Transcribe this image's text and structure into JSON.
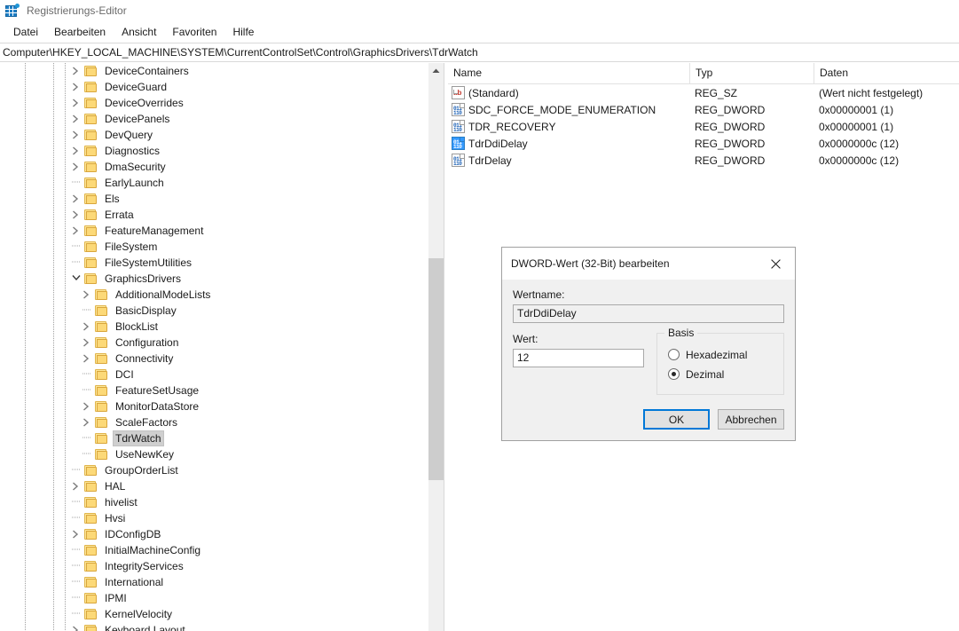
{
  "window": {
    "title": "Registrierungs-Editor",
    "icon": "registry-editor-icon"
  },
  "menubar": {
    "items": [
      {
        "label": "Datei"
      },
      {
        "label": "Bearbeiten"
      },
      {
        "label": "Ansicht"
      },
      {
        "label": "Favoriten"
      },
      {
        "label": "Hilfe"
      }
    ]
  },
  "addressbar": {
    "path": "Computer\\HKEY_LOCAL_MACHINE\\SYSTEM\\CurrentControlSet\\Control\\GraphicsDrivers\\TdrWatch"
  },
  "tree": {
    "nodes": [
      {
        "label": "DeviceContainers",
        "depth": 3,
        "twist": "collapsed",
        "selected": false
      },
      {
        "label": "DeviceGuard",
        "depth": 3,
        "twist": "collapsed",
        "selected": false
      },
      {
        "label": "DeviceOverrides",
        "depth": 3,
        "twist": "collapsed",
        "selected": false
      },
      {
        "label": "DevicePanels",
        "depth": 3,
        "twist": "collapsed",
        "selected": false
      },
      {
        "label": "DevQuery",
        "depth": 3,
        "twist": "collapsed",
        "selected": false
      },
      {
        "label": "Diagnostics",
        "depth": 3,
        "twist": "collapsed",
        "selected": false
      },
      {
        "label": "DmaSecurity",
        "depth": 3,
        "twist": "collapsed",
        "selected": false
      },
      {
        "label": "EarlyLaunch",
        "depth": 3,
        "twist": "none",
        "selected": false
      },
      {
        "label": "Els",
        "depth": 3,
        "twist": "collapsed",
        "selected": false
      },
      {
        "label": "Errata",
        "depth": 3,
        "twist": "collapsed",
        "selected": false
      },
      {
        "label": "FeatureManagement",
        "depth": 3,
        "twist": "collapsed",
        "selected": false
      },
      {
        "label": "FileSystem",
        "depth": 3,
        "twist": "none",
        "selected": false
      },
      {
        "label": "FileSystemUtilities",
        "depth": 3,
        "twist": "none",
        "selected": false
      },
      {
        "label": "GraphicsDrivers",
        "depth": 3,
        "twist": "expanded",
        "selected": false
      },
      {
        "label": "AdditionalModeLists",
        "depth": 4,
        "twist": "collapsed",
        "selected": false
      },
      {
        "label": "BasicDisplay",
        "depth": 4,
        "twist": "none",
        "selected": false
      },
      {
        "label": "BlockList",
        "depth": 4,
        "twist": "collapsed",
        "selected": false
      },
      {
        "label": "Configuration",
        "depth": 4,
        "twist": "collapsed",
        "selected": false
      },
      {
        "label": "Connectivity",
        "depth": 4,
        "twist": "collapsed",
        "selected": false
      },
      {
        "label": "DCI",
        "depth": 4,
        "twist": "none",
        "selected": false
      },
      {
        "label": "FeatureSetUsage",
        "depth": 4,
        "twist": "none",
        "selected": false
      },
      {
        "label": "MonitorDataStore",
        "depth": 4,
        "twist": "collapsed",
        "selected": false
      },
      {
        "label": "ScaleFactors",
        "depth": 4,
        "twist": "collapsed",
        "selected": false
      },
      {
        "label": "TdrWatch",
        "depth": 4,
        "twist": "none",
        "selected": true
      },
      {
        "label": "UseNewKey",
        "depth": 4,
        "twist": "none",
        "selected": false
      },
      {
        "label": "GroupOrderList",
        "depth": 3,
        "twist": "none",
        "selected": false
      },
      {
        "label": "HAL",
        "depth": 3,
        "twist": "collapsed",
        "selected": false
      },
      {
        "label": "hivelist",
        "depth": 3,
        "twist": "none",
        "selected": false
      },
      {
        "label": "Hvsi",
        "depth": 3,
        "twist": "none",
        "selected": false
      },
      {
        "label": "IDConfigDB",
        "depth": 3,
        "twist": "collapsed",
        "selected": false
      },
      {
        "label": "InitialMachineConfig",
        "depth": 3,
        "twist": "none",
        "selected": false
      },
      {
        "label": "IntegrityServices",
        "depth": 3,
        "twist": "none",
        "selected": false
      },
      {
        "label": "International",
        "depth": 3,
        "twist": "none",
        "selected": false
      },
      {
        "label": "IPMI",
        "depth": 3,
        "twist": "none",
        "selected": false
      },
      {
        "label": "KernelVelocity",
        "depth": 3,
        "twist": "none",
        "selected": false
      },
      {
        "label": "Keyboard Layout",
        "depth": 3,
        "twist": "collapsed",
        "selected": false
      }
    ]
  },
  "list": {
    "columns": [
      {
        "label": "Name"
      },
      {
        "label": "Typ"
      },
      {
        "label": "Daten"
      }
    ],
    "rows": [
      {
        "name": "(Standard)",
        "type": "REG_SZ",
        "data": "(Wert nicht festgelegt)",
        "icon": "reg-sz-icon",
        "selected": false
      },
      {
        "name": "SDC_FORCE_MODE_ENUMERATION",
        "type": "REG_DWORD",
        "data": "0x00000001 (1)",
        "icon": "reg-dword-icon",
        "selected": false
      },
      {
        "name": "TDR_RECOVERY",
        "type": "REG_DWORD",
        "data": "0x00000001 (1)",
        "icon": "reg-dword-icon",
        "selected": false
      },
      {
        "name": "TdrDdiDelay",
        "type": "REG_DWORD",
        "data": "0x0000000c (12)",
        "icon": "reg-dword-icon",
        "selected": true
      },
      {
        "name": "TdrDelay",
        "type": "REG_DWORD",
        "data": "0x0000000c (12)",
        "icon": "reg-dword-icon",
        "selected": false
      }
    ]
  },
  "dialog": {
    "title": "DWORD-Wert (32-Bit) bearbeiten",
    "close_label": "✕",
    "name_label": "Wertname:",
    "name_value": "TdrDdiDelay",
    "value_label": "Wert:",
    "value_value": "12",
    "basis_legend": "Basis",
    "basis_options": [
      {
        "label": "Hexadezimal",
        "checked": false
      },
      {
        "label": "Dezimal",
        "checked": true
      }
    ],
    "ok_label": "OK",
    "cancel_label": "Abbrechen"
  },
  "colors": {
    "selection_blue": "#3399ff",
    "accent_focus": "#0078d7",
    "folder_yellow": "#fcd978",
    "tree_selection_gray": "#cfcfcf"
  }
}
